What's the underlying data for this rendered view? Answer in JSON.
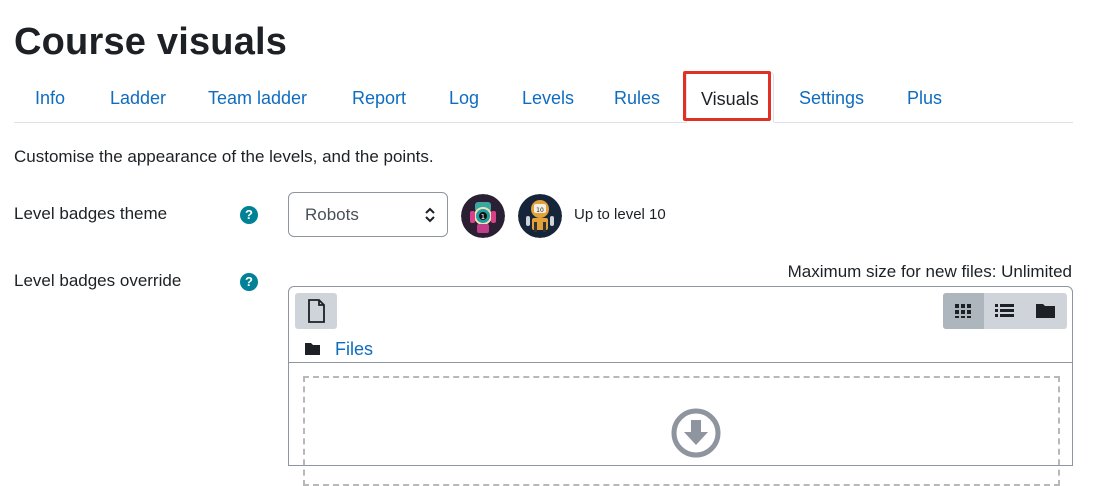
{
  "page": {
    "title": "Course visuals"
  },
  "tabs": [
    {
      "label": "Info"
    },
    {
      "label": "Ladder"
    },
    {
      "label": "Team ladder"
    },
    {
      "label": "Report"
    },
    {
      "label": "Log"
    },
    {
      "label": "Levels"
    },
    {
      "label": "Rules"
    },
    {
      "label": "Visuals",
      "active": true
    },
    {
      "label": "Settings"
    },
    {
      "label": "Plus"
    }
  ],
  "intro": "Customise the appearance of the levels, and the points.",
  "fields": {
    "theme": {
      "label": "Level badges theme",
      "help_icon": "question-circle-icon",
      "selected": "Robots",
      "note": "Up to level 10",
      "badge_icons": [
        "robot-badge-level-1",
        "robot-badge-level-10"
      ]
    },
    "override": {
      "label": "Level badges override",
      "help_icon": "question-circle-icon",
      "max_size": "Maximum size for new files: Unlimited"
    }
  },
  "filepicker": {
    "add_icon": "file-icon",
    "views": [
      "grid-icon",
      "list-icon",
      "folder-icon"
    ],
    "active_view": "grid-icon",
    "path_icon": "folder-icon",
    "path_label": "Files",
    "drop_icon": "download-arrow-circle-icon"
  },
  "colors": {
    "link": "#0f6cbf",
    "help": "#008196",
    "highlight": "#e03127"
  }
}
